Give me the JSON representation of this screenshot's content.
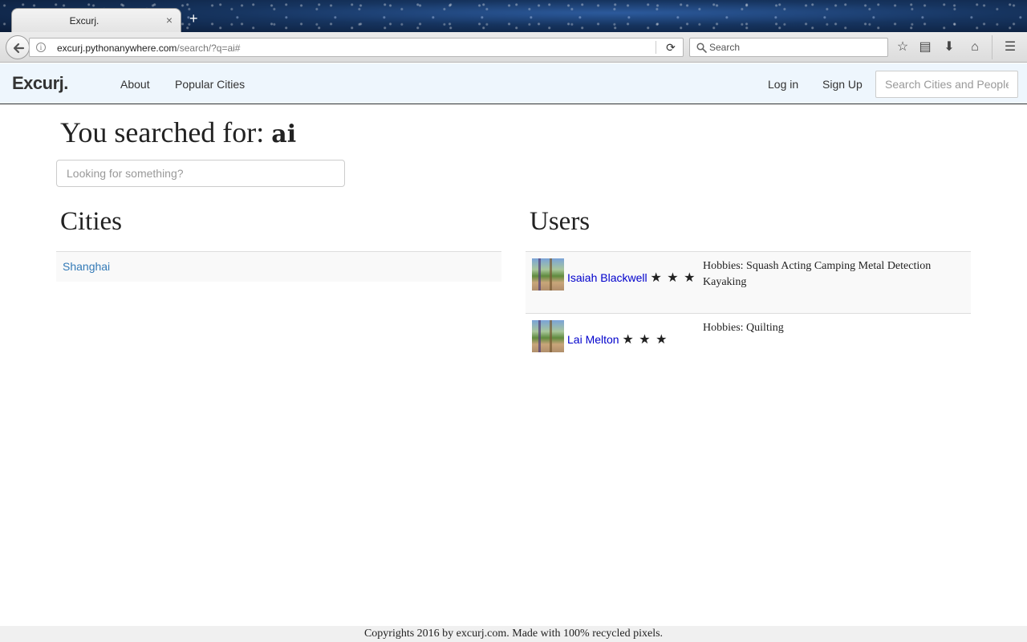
{
  "browser": {
    "tab_title": "Excurj.",
    "tab_close": "×",
    "new_tab": "+",
    "url_domain": "excurj.pythonanywhere.com",
    "url_path": "/search/?q=ai#",
    "search_placeholder": "Search",
    "icons": [
      "back-arrow-icon",
      "info-icon",
      "reload-icon",
      "search-icon",
      "bookmark-star-icon",
      "reading-list-icon",
      "download-icon",
      "home-icon",
      "menu-icon"
    ]
  },
  "header": {
    "brand": "Excurj.",
    "nav": [
      {
        "label": "About"
      },
      {
        "label": "Popular Cities"
      }
    ],
    "login_label": "Log in",
    "signup_label": "Sign Up",
    "search_placeholder": "Search Cities and People"
  },
  "main": {
    "title_prefix": "You searched for: ",
    "query": "ai",
    "search_placeholder": "Looking for something?",
    "cities_title": "Cities",
    "cities": [
      {
        "name": "Shanghai"
      }
    ],
    "users_title": "Users",
    "users": [
      {
        "name": "Isaiah Blackwell",
        "stars": "★ ★ ★",
        "rating": 3,
        "hobbies": "Hobbies: Squash Acting Camping Metal Detection Kayaking"
      },
      {
        "name": "Lai Melton",
        "stars": "★ ★ ★",
        "rating": 3,
        "hobbies": "Hobbies: Quilting"
      }
    ]
  },
  "footer": {
    "text": "Copyrights 2016 by excurj.com. Made with 100% recycled pixels."
  }
}
